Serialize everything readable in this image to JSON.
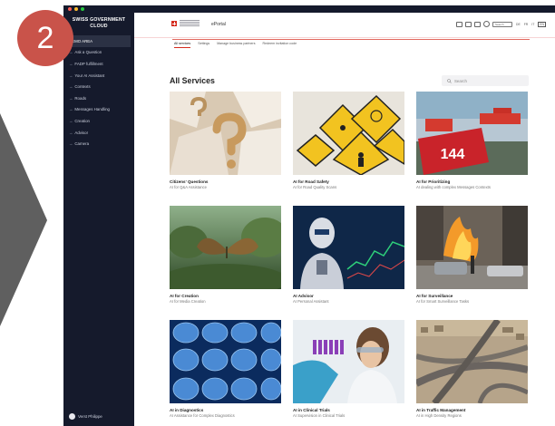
{
  "step_badge": "2",
  "colors": {
    "sidebar": "#151a2c",
    "accent": "#d52b1e",
    "badge": "#c9534a"
  },
  "sidebar": {
    "brand_line1": "SWISS GOVERNMENT",
    "brand_line2": "CLOUD",
    "items": [
      {
        "label": "DEMO AREA",
        "arrow": "",
        "active": true
      },
      {
        "label": "Ask a Question",
        "arrow": "→"
      },
      {
        "label": "FADP fulfillment",
        "arrow": "→"
      },
      {
        "label": "Your AI Assistant",
        "arrow": "→"
      },
      {
        "label": "Contexts",
        "arrow": "→"
      },
      {
        "label": "Roads",
        "arrow": "→"
      },
      {
        "label": "Messages Handling",
        "arrow": "→"
      },
      {
        "label": "Creation",
        "arrow": "→"
      },
      {
        "label": "Advisor",
        "arrow": "→"
      },
      {
        "label": "Camera",
        "arrow": "→"
      }
    ],
    "user_name": "Verst Philippe"
  },
  "header": {
    "portal_name": "ePortal",
    "search_label": "Search",
    "languages": [
      "DE",
      "FR",
      "IT",
      "EN"
    ]
  },
  "tabs": [
    "All services",
    "Settings",
    "Manage business partners",
    "Redeem invitation code"
  ],
  "main": {
    "title": "All Services",
    "search_placeholder": "Search"
  },
  "cards": [
    {
      "title": "Citizens' Questions",
      "subtitle": "AI for Q&A Assistance",
      "image": "question-mark-paper"
    },
    {
      "title": "AI for Road Safety",
      "subtitle": "AI for Road Quality Scans",
      "image": "road-signs"
    },
    {
      "title": "AI for Prioritizing",
      "subtitle": "AI dealing with complex Messages Contexts",
      "image": "emergency-144",
      "image_text": "144"
    },
    {
      "title": "AI for Creation",
      "subtitle": "AI for Media Creation",
      "image": "butterfly-landscape"
    },
    {
      "title": "AI Advisor",
      "subtitle": "AI Personal Assistant",
      "image": "robot-advisor"
    },
    {
      "title": "AI for Surveillance",
      "subtitle": "AI for Smart Surveillance Tasks",
      "image": "street-fire"
    },
    {
      "title": "AI in Diagnostics",
      "subtitle": "AI Assistance for Complex Diagnostics",
      "image": "brain-scans"
    },
    {
      "title": "AI in Clinical Trials",
      "subtitle": "AI Supervision in Clinical Trials",
      "image": "lab-scientist"
    },
    {
      "title": "AI in Traffic Management",
      "subtitle": "AI in High Density Regions",
      "image": "highway-interchange"
    }
  ]
}
